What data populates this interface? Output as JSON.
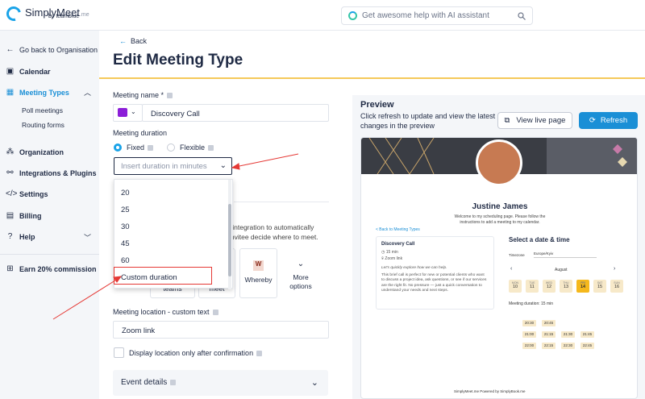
{
  "brand": {
    "name": "SimplyMeet",
    "tld": ".me",
    "sub": "by teamblue"
  },
  "search": {
    "placeholder": "Get awesome help with AI assistant"
  },
  "sidebar": {
    "back": "Go back to Organisation",
    "items": [
      {
        "label": "Calendar",
        "icon": "calendar-icon"
      },
      {
        "label": "Meeting Types",
        "icon": "calendar-grid-icon"
      },
      {
        "label": "Organization",
        "icon": "org-icon"
      },
      {
        "label": "Integrations & Plugins",
        "icon": "plug-icon"
      },
      {
        "label": "Settings",
        "icon": "code-icon"
      },
      {
        "label": "Billing",
        "icon": "card-icon"
      },
      {
        "label": "Help",
        "icon": "help-icon"
      },
      {
        "label": "Earn 20% commission",
        "icon": "gift-icon"
      }
    ],
    "subitems": [
      "Poll meetings",
      "Routing forms"
    ]
  },
  "main": {
    "back": "Back",
    "title": "Edit Meeting Type",
    "meeting_name_label": "Meeting name *",
    "meeting_name_value": "Discovery Call",
    "duration_label": "Meeting duration",
    "fixed": "Fixed",
    "flexible": "Flexible",
    "duration_placeholder": "Insert duration in minutes",
    "duration_options": [
      "20",
      "25",
      "30",
      "45",
      "60",
      "Custom duration"
    ],
    "integration_text_1": "le Meet integration to automatically",
    "integration_text_2": "t or let invitee decide where to meet.",
    "integration_tiles": [
      {
        "label": "teams"
      },
      {
        "label": "meet"
      },
      {
        "label": "Whereby"
      },
      {
        "label": "More options"
      }
    ],
    "custom_location_label": "Meeting location - custom text",
    "custom_location_value": "Zoom link",
    "display_after_confirm": "Display location only after confirmation",
    "event_details": "Event details"
  },
  "preview": {
    "title": "Preview",
    "desc": "Click refresh to update and view the latest changes in the preview",
    "view_live": "View live page",
    "refresh": "Refresh",
    "page": {
      "name": "Justine James",
      "welcome": "Welcome to my scheduling page. Please follow the instructions to add a meeting to my calendar.",
      "back": "< Back to Meeting Types",
      "event": "Discovery Call",
      "duration": "15 min",
      "location": "Zoom link",
      "desc_1": "Let's quickly explore how we can help.",
      "desc_2": "This brief call is perfect for new or potential clients who want to discuss a project idea, ask questions, or see if our services are the right fit. No pressure — just a quick conversation to understand your needs and next steps.",
      "select": "Select a date & time",
      "timezone_label": "Timezone",
      "timezone_value": "Europe/Kyiv",
      "month": "August",
      "days": [
        {
          "n": "10",
          "w": "MON"
        },
        {
          "n": "11",
          "w": "TUE"
        },
        {
          "n": "12",
          "w": "WED"
        },
        {
          "n": "13",
          "w": "THU"
        },
        {
          "n": "14",
          "w": "FRI"
        },
        {
          "n": "15",
          "w": "SAT"
        },
        {
          "n": "16",
          "w": "SUN"
        }
      ],
      "meeting_duration": "Meeting duration: 15 min",
      "slots": [
        "20:30",
        "20:45",
        "21:00",
        "21:15",
        "21:30",
        "21:45",
        "22:00",
        "22:15",
        "22:30",
        "22:45"
      ],
      "footer": "SimplyMeet.me    Powered by    SimplyBook.me"
    }
  }
}
